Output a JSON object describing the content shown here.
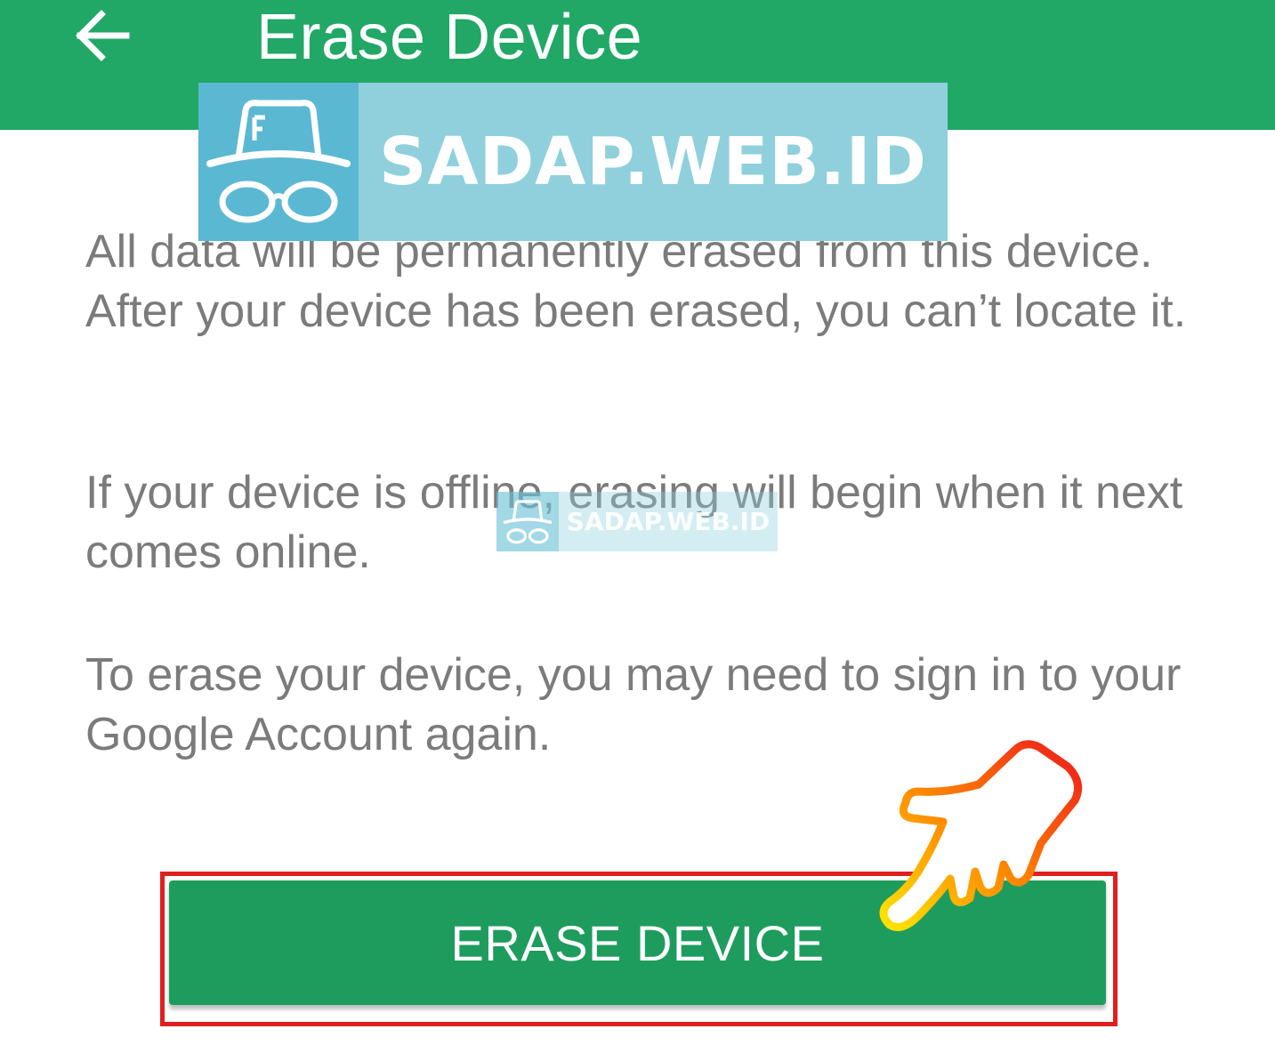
{
  "app_bar": {
    "title": "Erase Device",
    "background_color": "#21a866",
    "back_icon": "arrow-left-icon"
  },
  "watermark": {
    "text": "SADAP.WEB.ID",
    "icon": "incognito-hat-glasses-icon"
  },
  "watermark_small": {
    "text": "SADAP.WEB.ID",
    "icon": "incognito-hat-glasses-icon"
  },
  "content": {
    "paragraphs": [
      "All data will be permanently erased from this device. After your device has been erased, you can’t locate it.",
      "If your device is offline, erasing will begin when it next comes online.",
      "To erase your device, you may need to sign in to your Google Account again."
    ],
    "text_color": "#7b7b7b"
  },
  "action": {
    "button_label": "ERASE DEVICE",
    "button_color": "#1e9c5d",
    "highlight_color": "#e0201e",
    "pointer_icon": "pointing-hand-icon"
  }
}
